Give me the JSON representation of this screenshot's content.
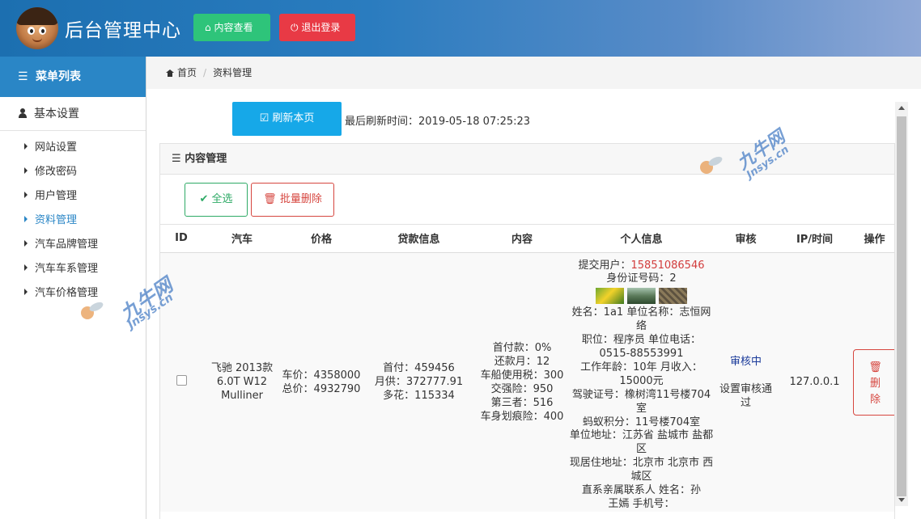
{
  "header": {
    "title": "后台管理中心",
    "view_button": "内容查看",
    "logout_button": "退出登录"
  },
  "sidebar": {
    "menu_title": "菜单列表",
    "section_title": "基本设置",
    "items": [
      {
        "label": "网站设置",
        "active": false
      },
      {
        "label": "修改密码",
        "active": false
      },
      {
        "label": "用户管理",
        "active": false
      },
      {
        "label": "资料管理",
        "active": true
      },
      {
        "label": "汽车品牌管理",
        "active": false
      },
      {
        "label": "汽车车系管理",
        "active": false
      },
      {
        "label": "汽车价格管理",
        "active": false
      }
    ]
  },
  "breadcrumb": {
    "home": "首页",
    "current": "资料管理"
  },
  "toolbar": {
    "refresh_label": "刷新本页",
    "refresh_time": "最后刷新时间：2019-05-18 07:25:23"
  },
  "panel": {
    "title": "内容管理",
    "select_all": "全选",
    "batch_delete": "批量删除"
  },
  "table": {
    "columns": [
      "ID",
      "汽车",
      "价格",
      "贷款信息",
      "内容",
      "个人信息",
      "审核",
      "IP/时间",
      "操作"
    ],
    "row": {
      "car": "飞驰 2013款 6.0T W12 Mulliner",
      "price": {
        "car_price": "车价：4358000",
        "total_price": "总价：4932790"
      },
      "loan": {
        "down_payment": "首付：459456",
        "monthly": "月供：372777.91",
        "extra": "多花：115334"
      },
      "content": {
        "down_ratio": "首付款：0%",
        "months": "还款月：12",
        "vessel_tax": "车船使用税：300",
        "compulsory": "交强险：950",
        "third_party": "第三者：516",
        "scratch": "车身划痕险：400"
      },
      "personal": {
        "submit_user_label": "提交用户：",
        "submit_user_phone": "15851086546",
        "id_number": "身份证号码：2",
        "name_company": "姓名：1a1 单位名称：志恒网络",
        "position_phone": "职位：程序员 单位电话：0515-88553991",
        "work_income": "工作年龄：10年 月收入：15000元",
        "license": "驾驶证号：橡树湾11号楼704室",
        "antcredit": "蚂蚁积分：11号楼704室",
        "company_address": "单位地址：江苏省 盐城市 盐都区",
        "home_address": "现居住地址：北京市 北京市 西城区",
        "relative": "直系亲属联系人 姓名：孙",
        "relative_phone": "王嫣 手机号："
      },
      "audit": {
        "status": "审核中",
        "action": "设置审核通过"
      },
      "ip": "127.0.0.1",
      "delete_label": "删除"
    }
  },
  "watermark": {
    "text_cn": "九牛网",
    "text_en": "Jnsys.cn"
  },
  "colors": {
    "primary": "#2a86c6",
    "success": "#2ec47a",
    "danger": "#e83a45"
  }
}
